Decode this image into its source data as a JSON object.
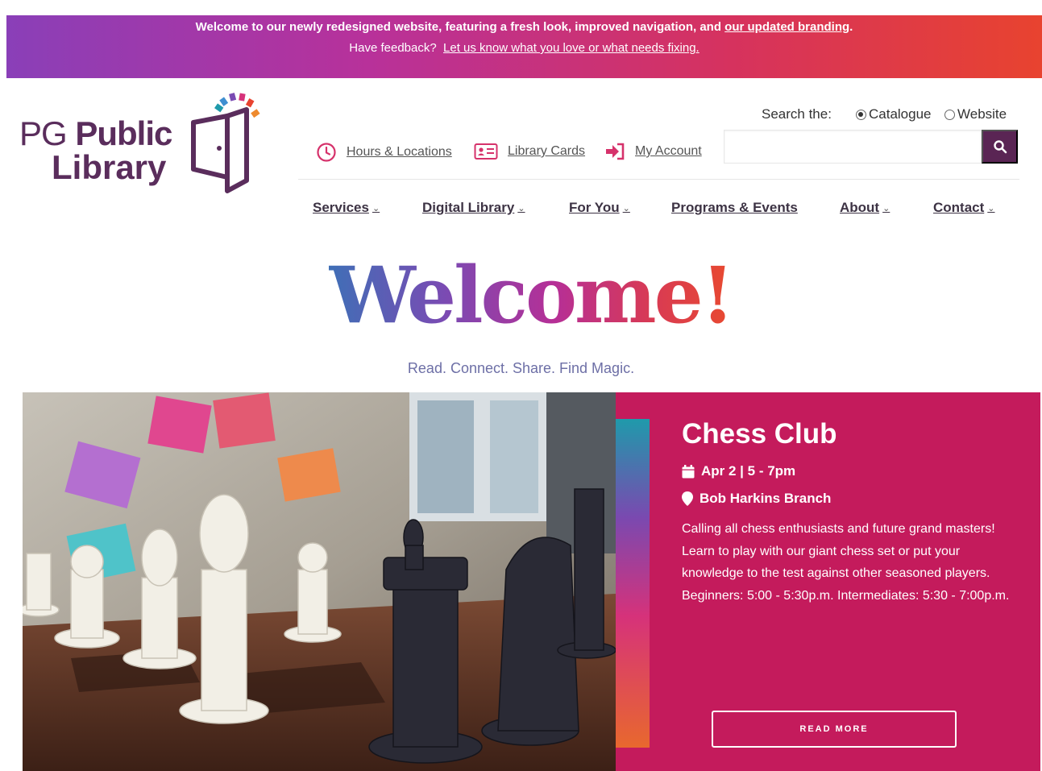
{
  "banner": {
    "line1_text": "Welcome to our newly redesigned website, featuring a fresh look, improved navigation, and ",
    "line1_link": "our updated branding",
    "line1_end": ".",
    "line2_text": "Have feedback?",
    "line2_link": "Let us know what you love or what needs fixing."
  },
  "logo": {
    "pg": "PG",
    "public": "Public",
    "library": "Library"
  },
  "utility": {
    "hours": "Hours & Locations",
    "cards": "Library Cards",
    "account": "My Account"
  },
  "search": {
    "label": "Search the:",
    "options": [
      "Catalogue",
      "Website"
    ],
    "selected": "Catalogue",
    "value": ""
  },
  "nav": {
    "services": "Services",
    "digital": "Digital Library",
    "foryou": "For You",
    "programs": "Programs & Events",
    "about": "About",
    "contact": "Contact"
  },
  "hero": {
    "welcome": "Welcome!",
    "tagline": "Read. Connect. Share. Find Magic."
  },
  "event": {
    "title": "Chess Club",
    "date": "Apr 2 | 5 - 7pm",
    "location": "Bob Harkins Branch",
    "description": "Calling all chess enthusiasts and future grand masters! Learn to play with our giant chess set or put your knowledge to the test against other seasoned players. Beginners: 5:00 - 5:30p.m. Intermediates: 5:30 - 7:00p.m.",
    "button": "READ MORE"
  },
  "colors": {
    "brand_purple": "#5a2554",
    "event_panel": "#c41b5c",
    "accent_orange": "#e8432f"
  },
  "icons": {
    "hours": "clock-icon",
    "cards": "library-card-icon",
    "account": "sign-in-icon",
    "search": "search-icon",
    "date": "calendar-icon",
    "location": "map-pin-icon"
  }
}
